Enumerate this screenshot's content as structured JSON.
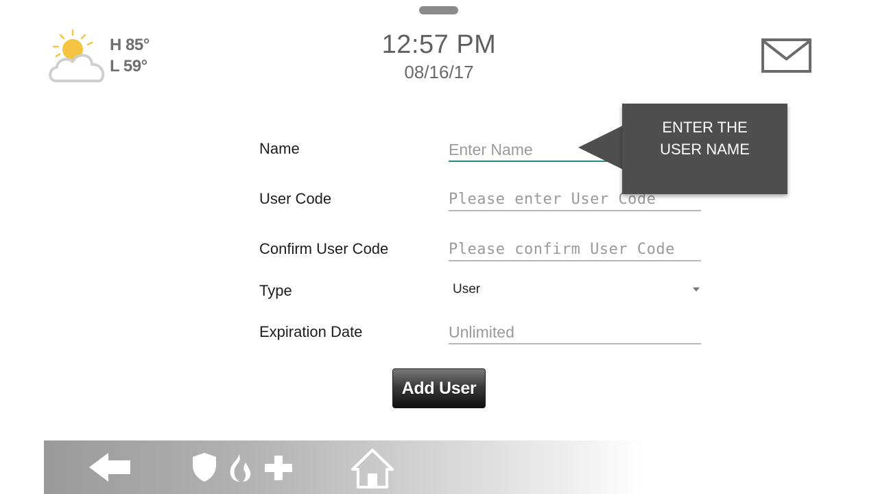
{
  "weather": {
    "high": "H 85°",
    "low": "L 59°",
    "icon": "partly-sunny-icon"
  },
  "clock": {
    "time": "12:57 PM",
    "date": "08/16/17"
  },
  "messages": {
    "icon": "mail-icon"
  },
  "form": {
    "name": {
      "label": "Name",
      "placeholder": "Enter Name",
      "value": ""
    },
    "user_code": {
      "label": "User Code",
      "placeholder": "Please enter User Code",
      "value": ""
    },
    "confirm_user_code": {
      "label": "Confirm User Code",
      "placeholder": "Please confirm User Code",
      "value": ""
    },
    "type": {
      "label": "Type",
      "selected": "User"
    },
    "expiration_date": {
      "label": "Expiration Date",
      "placeholder": "Unlimited",
      "value": ""
    },
    "add_user_label": "Add User"
  },
  "tooltip": {
    "text": "ENTER THE USER NAME"
  },
  "bottom_bar": {
    "icons": [
      "back-arrow-icon",
      "shield-icon",
      "flame-icon",
      "medical-cross-icon",
      "home-icon"
    ]
  },
  "colors": {
    "focus_underline": "#2a8a7f",
    "tooltip_bg": "#4e4e4e",
    "sun": "#f5c542"
  }
}
